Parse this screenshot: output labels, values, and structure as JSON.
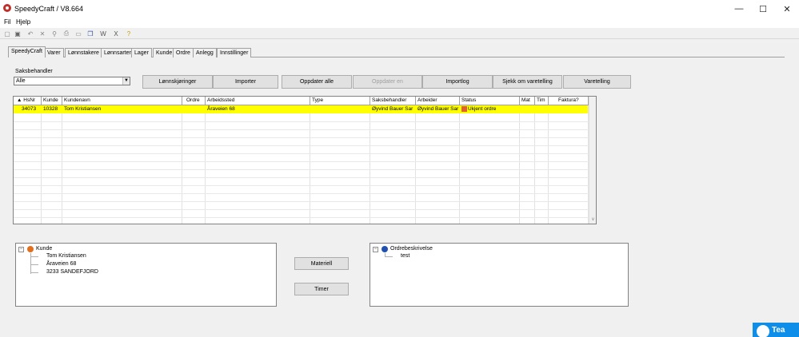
{
  "window": {
    "title": "SpeedyCraft  / V8.664",
    "minimize": "—",
    "maximize": "☐",
    "close": "✕"
  },
  "menu": [
    "Fil",
    "Hjelp"
  ],
  "toolbar_icons": [
    "new-icon",
    "save-icon",
    "undo-icon",
    "delete-icon",
    "find-icon",
    "print-icon",
    "form-icon",
    "copy-icon",
    "word-icon",
    "excel-icon",
    "help-icon"
  ],
  "tabs": [
    "SpeedyCraft",
    "Varer",
    "Lønnstakere",
    "Lønnsarter",
    "Lager",
    "Kunde",
    "Ordre",
    "Anlegg",
    "Innstillinger"
  ],
  "saksbehandler": {
    "label": "Saksbehandler",
    "value": "Alle"
  },
  "buttons": {
    "lonnskjoringer": "Lønnskjøringer",
    "importer": "Importer",
    "oppdater_alle": "Oppdater alle",
    "oppdater_en": "Oppdater en",
    "importlog": "Importlog",
    "sjekk": "Sjekk om varetelling",
    "varetelling": "Varetelling",
    "materiell": "Materiell",
    "timer": "Timer"
  },
  "grid": {
    "columns": [
      "HsNr",
      "Kunde",
      "Kundenavn",
      "Ordre",
      "Arbeidssted",
      "Type",
      "Saksbehandler",
      "Arbeider",
      "Status",
      "Mat",
      "Tim",
      "Faktura?"
    ],
    "rows": [
      {
        "hsnr": "34073",
        "kunde": "10328",
        "kundenavn": "Tom Kristiansen",
        "ordre": "",
        "arbeidssted": "Åraveien 68",
        "type": "",
        "saksbehandler": "Øyvind Bauer Sar",
        "arbeider": "Øyvind Bauer Sar",
        "status": "Ukjent ordre",
        "mat": "",
        "tim": "",
        "faktura": ""
      }
    ]
  },
  "kunde_tree": {
    "root": "Kunde",
    "items": [
      "Tom Kristiansen",
      "Åraveien 68",
      "3233  SANDEFJORD"
    ]
  },
  "ordre_tree": {
    "root": "Ordrebeskrivelse",
    "items": [
      "test"
    ]
  },
  "teamviewer": {
    "label": "Tea"
  },
  "colors": {
    "highlight_row": "#ffff00",
    "teamviewer": "#0e8ee9"
  }
}
